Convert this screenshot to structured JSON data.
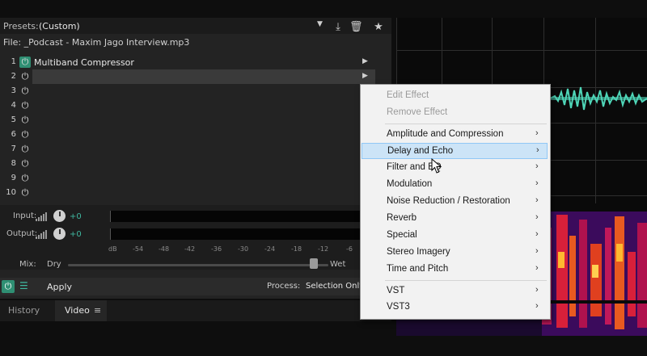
{
  "presets": {
    "label": "Presets:",
    "value": "(Custom)"
  },
  "file": {
    "label": "File: _Podcast - Maxim Jago Interview.mp3"
  },
  "slots": [
    {
      "num": "1",
      "name": "Multiband Compressor"
    },
    {
      "num": "2",
      "name": ""
    },
    {
      "num": "3",
      "name": ""
    },
    {
      "num": "4",
      "name": ""
    },
    {
      "num": "5",
      "name": ""
    },
    {
      "num": "6",
      "name": ""
    },
    {
      "num": "7",
      "name": ""
    },
    {
      "num": "8",
      "name": ""
    },
    {
      "num": "9",
      "name": ""
    },
    {
      "num": "10",
      "name": ""
    }
  ],
  "io": {
    "input_label": "Input:",
    "input_gain": "+0",
    "output_label": "Output:",
    "output_gain": "+0"
  },
  "scale": [
    "dB",
    "-54",
    "-48",
    "-42",
    "-36",
    "-30",
    "-24",
    "-18",
    "-12",
    "-6"
  ],
  "mix": {
    "label": "Mix:",
    "dry": "Dry",
    "wet": "Wet",
    "level": 0.96
  },
  "bottom": {
    "apply": "Apply",
    "process_label": "Process:",
    "process_value": "Selection Only"
  },
  "tabs": {
    "history": "History",
    "video": "Video"
  },
  "menu": {
    "edit_effect": "Edit Effect",
    "remove_effect": "Remove Effect",
    "items": [
      "Amplitude and Compression",
      "Delay and Echo",
      "Filter and EQ",
      "Modulation",
      "Noise Reduction / Restoration",
      "Reverb",
      "Special",
      "Stereo Imagery",
      "Time and Pitch"
    ],
    "vst": "VST",
    "vst3": "VST3"
  },
  "colors": {
    "accent": "#2f8f73",
    "waveform": "#4fd6b8",
    "highlight": "#cce4f7"
  }
}
